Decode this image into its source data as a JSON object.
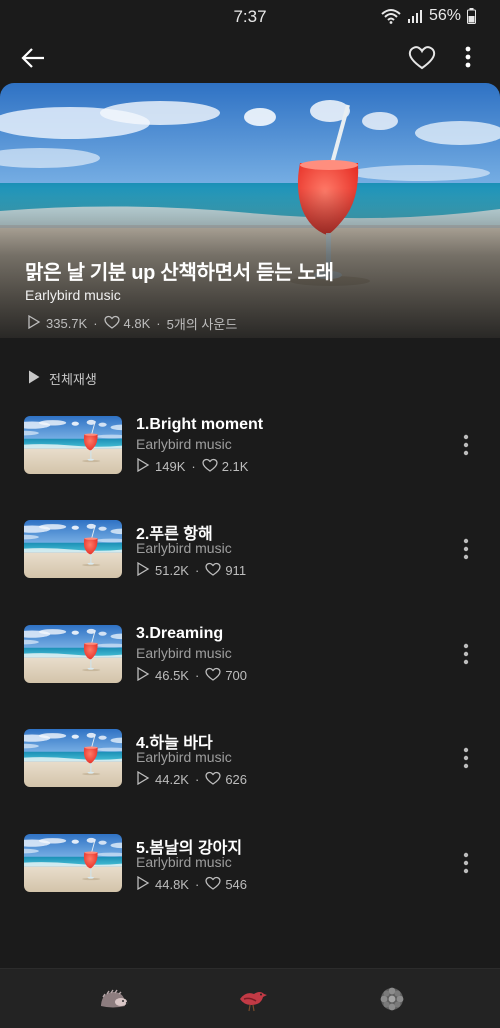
{
  "status_bar": {
    "time": "7:37",
    "battery": "56%"
  },
  "app_bar": {
    "icons": [
      "back-arrow-icon",
      "heart-outline-icon",
      "more-vertical-icon"
    ]
  },
  "playlist": {
    "title": "맑은 날 기분 up 산책하면서 듣는 노래",
    "artist": "Earlybird music",
    "plays": "335.7K",
    "likes": "4.8K",
    "sound_count": "5개의 사운드"
  },
  "play_all_label": "전체재생",
  "separator": "·",
  "tracks": [
    {
      "title": "1.Bright moment",
      "artist": "Earlybird music",
      "plays": "149K",
      "likes": "2.1K"
    },
    {
      "title": "2.푸른 항해",
      "artist": "Earlybird music",
      "plays": "51.2K",
      "likes": "911"
    },
    {
      "title": "3.Dreaming",
      "artist": "Earlybird music",
      "plays": "46.5K",
      "likes": "700"
    },
    {
      "title": "4.하늘 바다",
      "artist": "Earlybird music",
      "plays": "44.2K",
      "likes": "626"
    },
    {
      "title": "5.봄날의 강아지",
      "artist": "Earlybird music",
      "plays": "44.8K",
      "likes": "546"
    }
  ],
  "bottom_nav": {
    "items": [
      "hedgehog-icon",
      "bird-icon",
      "flower-icon"
    ]
  },
  "colors": {
    "background": "#1b1b1b",
    "bottom_nav_bg": "#232323",
    "secondary_text": "#9e9e9e",
    "stat_text": "#bdbdbd"
  }
}
